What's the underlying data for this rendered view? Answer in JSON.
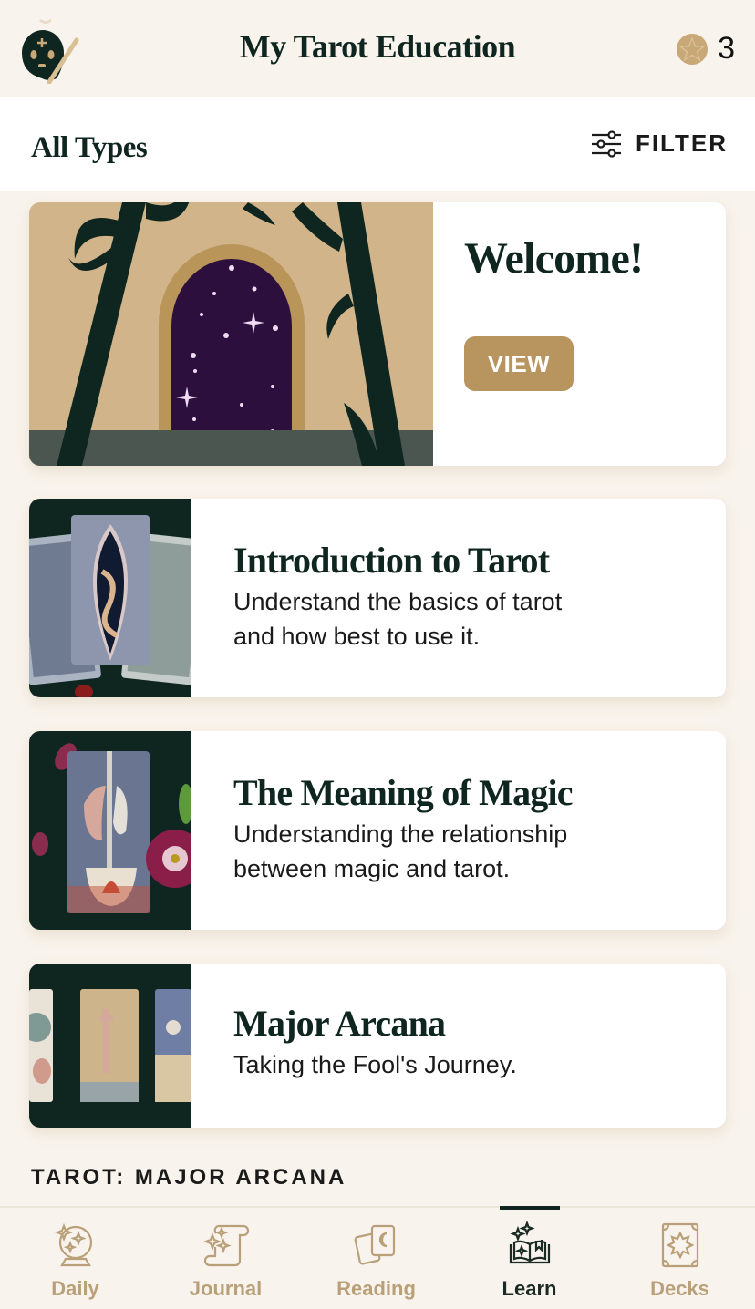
{
  "header": {
    "title": "My Tarot Education",
    "coin_count": "3",
    "avatar_icon": "ghost-wizard-avatar-icon",
    "coin_icon": "pentacle-coin-icon"
  },
  "filter_bar": {
    "type_label": "All Types",
    "filter_label": "FILTER",
    "filter_icon": "sliders-icon"
  },
  "welcome_card": {
    "title": "Welcome!",
    "button_label": "VIEW",
    "image": "starry-doorway-illustration"
  },
  "courses": [
    {
      "title": "Introduction to Tarot",
      "description_line1": "Understand the basics of tarot",
      "description_line2": "and how best to use it.",
      "image": "tarot-cards-illustration"
    },
    {
      "title": "The Meaning of Magic",
      "description_line1": "Understanding the relationship",
      "description_line2": "between magic and tarot.",
      "image": "magician-card-flowers-illustration"
    },
    {
      "title": "Major Arcana",
      "description_line1": "Taking the Fool's Journey.",
      "image": "major-arcana-cards-illustration"
    }
  ],
  "section_label": "TAROT: MAJOR ARCANA",
  "tabbar": {
    "active": "Learn",
    "tabs": [
      {
        "label": "Daily",
        "icon": "crystal-ball-icon"
      },
      {
        "label": "Journal",
        "icon": "scroll-icon"
      },
      {
        "label": "Reading",
        "icon": "cards-moon-icon"
      },
      {
        "label": "Learn",
        "icon": "open-book-sparkles-icon"
      },
      {
        "label": "Decks",
        "icon": "deck-star-icon"
      }
    ]
  },
  "colors": {
    "background": "#f8f3ec",
    "primary_dark": "#0f2620",
    "accent_gold": "#b8955e",
    "inactive_tab": "#b9a078"
  }
}
